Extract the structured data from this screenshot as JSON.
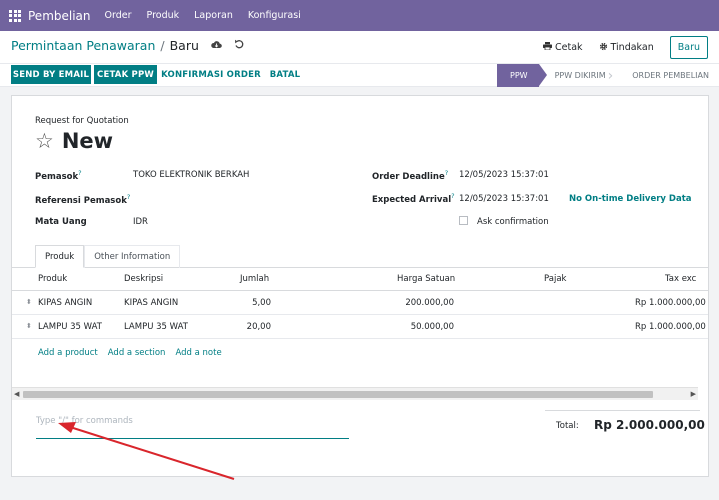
{
  "app": {
    "name": "Pembelian"
  },
  "nav": [
    "Order",
    "Produk",
    "Laporan",
    "Konfigurasi"
  ],
  "breadcrumb": {
    "parent": "Permintaan Penawaran",
    "separator": "/",
    "current": "Baru"
  },
  "actions": {
    "print": "Cetak",
    "action": "Tindakan",
    "new": "Baru"
  },
  "toolbar": {
    "send_email": "SEND BY EMAIL",
    "print_rfq": "CETAK PPW",
    "confirm_order": "KONFIRMASI ORDER",
    "cancel": "BATAL"
  },
  "stages": [
    {
      "label": "PPW",
      "active": true
    },
    {
      "label": "PPW DIKIRIM",
      "active": false
    },
    {
      "label": "ORDER PEMBELIAN",
      "active": false
    }
  ],
  "form": {
    "doc_label": "Request for Quotation",
    "title": "New",
    "vendor_label": "Pemasok",
    "vendor_value": "TOKO ELEKTRONIK BERKAH",
    "vendor_ref_label": "Referensi Pemasok",
    "currency_label": "Mata Uang",
    "currency_value": "IDR",
    "deadline_label": "Order Deadline",
    "deadline_value": "12/05/2023 15:37:01",
    "arrival_label": "Expected Arrival",
    "arrival_value": "12/05/2023 15:37:01",
    "on_time_link": "No On-time Delivery Data",
    "ask_confirm_label": "Ask confirmation",
    "help_mark": "?"
  },
  "tabs": [
    {
      "label": "Produk",
      "active": true
    },
    {
      "label": "Other Information",
      "active": false
    }
  ],
  "table": {
    "headers": [
      "Produk",
      "Deskripsi",
      "Jumlah",
      "Harga Satuan",
      "Pajak",
      "Tax exc"
    ],
    "rows": [
      {
        "product": "KIPAS ANGIN",
        "description": "KIPAS ANGIN",
        "qty": "5,00",
        "price": "200.000,00",
        "tax": "",
        "subtotal": "Rp 1.000.000,00"
      },
      {
        "product": "LAMPU 35 WAT",
        "description": "LAMPU 35 WAT",
        "qty": "20,00",
        "price": "50.000,00",
        "tax": "",
        "subtotal": "Rp 1.000.000,00"
      }
    ],
    "add_links": [
      "Add a product",
      "Add a section",
      "Add a note"
    ]
  },
  "notes": {
    "placeholder": "Type \"/\" for commands"
  },
  "totals": {
    "label": "Total:",
    "value": "Rp 2.000.000,00"
  },
  "colors": {
    "navbar": "#71639e",
    "primary": "#017e84",
    "annotation_arrow": "#d9262c"
  },
  "icons": [
    "apps-grid-icon",
    "cloud-save-icon",
    "undo-icon",
    "print-icon",
    "gear-icon",
    "star-icon",
    "drag-handle-icon",
    "scroll-left-icon",
    "scroll-right-icon"
  ]
}
